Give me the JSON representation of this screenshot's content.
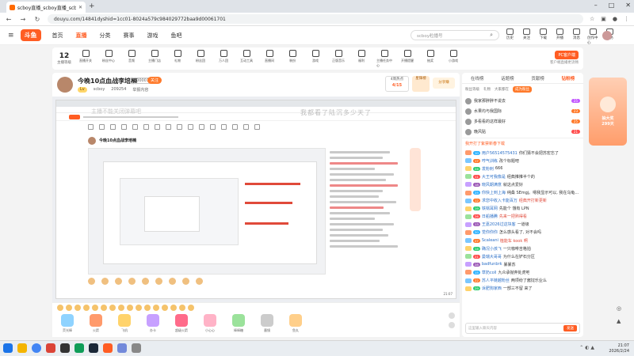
{
  "browser": {
    "tab_title": "scboy直播_scboy直播_scboy视",
    "url": "douyu.com/14841dyshid=1cc01-8024a579c984029772baa9d00061701"
  },
  "site": {
    "logo": "斗鱼",
    "nav": [
      "首页",
      "直播",
      "分类",
      "赛事",
      "游戏",
      "鱼吧"
    ],
    "search_placeholder": "scboy粒播号",
    "top_icons": [
      "历史",
      "关注",
      "下载",
      "开播",
      "消息",
      "创作中心",
      "任务"
    ]
  },
  "categories": {
    "level_num": "12",
    "level_label": "主播等级",
    "items": [
      "直播开关",
      "粉丝中心",
      "音频",
      "主播门店",
      "礼物",
      "粉丝团",
      "万人团",
      "互动工具",
      "直播间",
      "装扮",
      "游戏",
      "正版音乐",
      "福利",
      "主播任务中心",
      "开播提醒",
      "抽奖",
      "小游戏"
    ],
    "pc_button": "PC客户端",
    "pc_sub": "客户端直播更流畅"
  },
  "room": {
    "title": "今晚10点血战李培楠",
    "room_id": "(100001)",
    "follow_label": "关注",
    "streamer": "scboy",
    "fans": "209254",
    "report": "举报内容",
    "hot_label": "4周热点",
    "hot_value": "4/15",
    "rank_label": "星辉榜",
    "share_label": "分享赚"
  },
  "player": {
    "danmu_top": "我都看了陆沉多少天了",
    "danmu_left": "主播不能关闭弹幕吧",
    "time": "21:07"
  },
  "gifts": [
    "荧光棒",
    "火箭",
    "飞机",
    "办卡",
    "超级火箭",
    "小心心",
    "棒棒糖",
    "墨镜",
    "鱼丸"
  ],
  "right_panel": {
    "tabs": [
      "在线榜",
      "话题榜",
      "贡献榜",
      "钻粉榜"
    ],
    "subtabs": [
      "粉丝等级",
      "礼物",
      "大家都在",
      "成为粉丝"
    ],
    "ranks": [
      {
        "name": "我家那胖胖不说去",
        "badge": "25"
      },
      {
        "name": "水果均与我国际",
        "badge": "23"
      },
      {
        "name": "多看看的这样最好",
        "badge": "25"
      },
      {
        "name": "晚风贴",
        "badge": "21"
      }
    ],
    "chat_header": "我开打了紫禁新春下载",
    "messages": [
      {
        "user": "用户56514575431",
        "text": "你们猜不会把苏宏忘了",
        "hl": false
      },
      {
        "user": "哼气训练",
        "text": "改个标题吧",
        "hl": false
      },
      {
        "user": "发粉刺",
        "text": "666",
        "hl": false
      },
      {
        "user": "大王可我像是",
        "text": "经典推推半个的",
        "hl": false
      },
      {
        "user": "晓风期满意",
        "text": "就这点爱好",
        "hl": false
      },
      {
        "user": "你快上到上海",
        "text": "纯桑 SEmgj。嗯我显示可以, 我在乌龟壳里等你",
        "hl": false
      },
      {
        "user": "求您中收入卡能百万",
        "text": "经典开打新更新",
        "hl": true
      },
      {
        "user": "铁锅耳网",
        "text": "先能个 饿有 LPN",
        "hl": false
      },
      {
        "user": "日船播腾",
        "text": "先来一把熟得看",
        "hl": true
      },
      {
        "user": "王嘉2026过这块客",
        "text": "一道级",
        "hl": false
      },
      {
        "user": "觉你你你",
        "text": "怎么感头看了, 对不会吗",
        "hl": false
      },
      {
        "user": "Scaleani",
        "text": "植能车 kook 啊",
        "hl": true
      },
      {
        "user": "确况小孩飞",
        "text": "一只咖啡吉格拍",
        "hl": false
      },
      {
        "user": "曼瑞大哥哥",
        "text": "为什么在铲石分区",
        "hl": false
      },
      {
        "user": "badfunbrk",
        "text": "暴暴苏",
        "hl": false
      },
      {
        "user": "草奶coll",
        "text": "九众承抛弃处虎吧",
        "hl": false
      },
      {
        "user": "苏人平链越粉丝",
        "text": "两项纷了酱挝乐业么",
        "hl": false
      },
      {
        "user": "诉肥狗家西",
        "text": "一部三不留 来了",
        "hl": false
      }
    ],
    "input_placeholder": "这里输入聊天内容",
    "send_label": "发送"
  },
  "float_ad": {
    "line1": "抽大奖",
    "line2": "299天"
  },
  "taskbar": {
    "time": "21:07",
    "date": "2026/2/24"
  }
}
